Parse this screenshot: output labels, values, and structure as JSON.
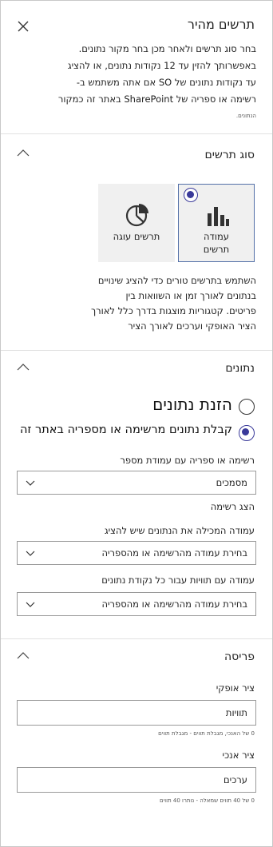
{
  "panel": {
    "title": "תרשים מהיר",
    "intro": [
      "בחר סוג תרשים ולאחר מכן בחר מקור נתונים.",
      "באפשרותך להזין עד 12 נקודות נתונים, או להציג",
      "עד נקודות נתונים של SO אם אתה משתמש ב-",
      "רשימה או ספריה של SharePoint באתר זה כמקור"
    ],
    "intro_tail": "הנתונים."
  },
  "chart_type": {
    "title": "סוג תרשים",
    "tiles": [
      {
        "label_line1": "עמודה",
        "label_line2": "תרשים",
        "selected": true,
        "icon": "bar-chart-icon"
      },
      {
        "label_line1": "תרשים עוגה",
        "label_line2": "",
        "selected": false,
        "icon": "pie-chart-icon"
      }
    ],
    "description": [
      "השתמש בתרשים טורים כדי להציג שינויים",
      "בנתונים לאורך זמן או השוואות בין",
      "פריטים. קטגוריות מוצגות בדרך כלל לאורך",
      "הציר האופקי וערכים לאורך הציר"
    ]
  },
  "data": {
    "title": "נתונים",
    "option_enter": "הזנת נתונים",
    "option_get": "קבלת נתונים מרשימה או מספריה באתר זה",
    "selected_option": "get",
    "list_label": "רשימה או ספריה עם עמודת מספר",
    "list_value": "מסמכים",
    "show_list": "הצג רשימה",
    "column_label": "עמודה המכילה את הנתונים שיש להציג",
    "column_value": "בחירת עמודה מהרשימה או מהספריה",
    "labels_label": "עמודה עם תוויות עבור כל נקודת נתונים",
    "labels_value": "בחירת עמודה מהרשימה או מהספריה"
  },
  "layout": {
    "title": "פריסה",
    "x_axis_label": "ציר אופקי",
    "x_axis_value": "תוויות",
    "x_axis_hint": "0 של האנכי, מגבלת תווים - מגבלת תווים",
    "y_axis_label": "ציר אנכי",
    "y_axis_value": "ערכים",
    "y_axis_hint": "0 של 40 תווים שמאלה - נותרו 40 תווים"
  },
  "colors": {
    "accent": "#3a3a9a",
    "border": "#9a9a9a",
    "tile_bg": "#f0f0f0"
  }
}
